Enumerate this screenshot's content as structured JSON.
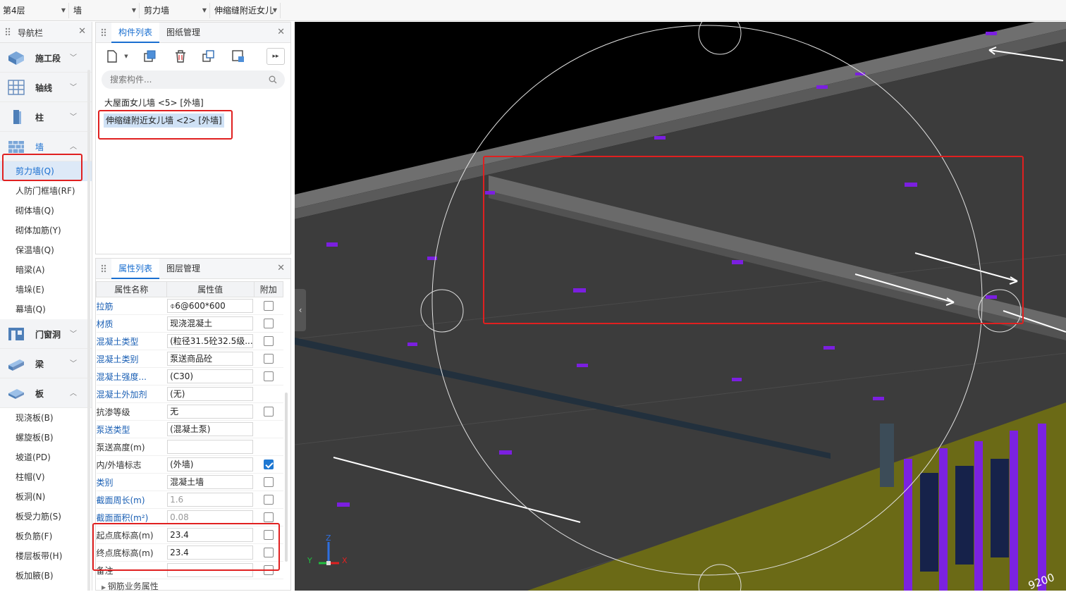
{
  "topbar": {
    "floor": "第4层",
    "type": "墙",
    "subtype": "剪力墙",
    "component": "伸缩缝附近女儿"
  },
  "nav": {
    "title": "导航栏",
    "cats": {
      "stage": "施工段",
      "axis": "轴线",
      "column": "柱",
      "wall": "墙",
      "opening": "门窗洞",
      "beam": "梁",
      "slab": "板"
    },
    "wall_items": [
      "剪力墙(Q)",
      "人防门框墙(RF)",
      "砌体墙(Q)",
      "砌体加筋(Y)",
      "保温墙(Q)",
      "暗梁(A)",
      "墙垛(E)",
      "幕墙(Q)"
    ],
    "slab_items": [
      "现浇板(B)",
      "螺旋板(B)",
      "坡道(PD)",
      "柱帽(V)",
      "板洞(N)",
      "板受力筋(S)",
      "板负筋(F)",
      "楼层板带(H)",
      "板加腋(B)"
    ]
  },
  "component_panel": {
    "tab1": "构件列表",
    "tab2": "图纸管理",
    "search_placeholder": "搜索构件...",
    "items": [
      "大屋面女儿墙 <5> [外墙]",
      "伸缩缝附近女儿墙 <2> [外墙]"
    ]
  },
  "props_panel": {
    "tab1": "属性列表",
    "tab2": "图层管理",
    "col_name": "属性名称",
    "col_value": "属性值",
    "col_extra": "附加",
    "rows": [
      {
        "name": "拉筋",
        "value": "⌽6@600*600"
      },
      {
        "name": "材质",
        "value": "现浇混凝土"
      },
      {
        "name": "混凝土类型",
        "value": "(粒径31.5砼32.5级..."
      },
      {
        "name": "混凝土类别",
        "value": "泵送商品砼"
      },
      {
        "name": "混凝土强度...",
        "value": "(C30)"
      },
      {
        "name": "混凝土外加剂",
        "value": "(无)"
      },
      {
        "name": "抗渗等级",
        "value": "无"
      },
      {
        "name": "泵送类型",
        "value": "(混凝土泵)"
      },
      {
        "name": "泵送高度(m)",
        "value": ""
      },
      {
        "name": "内/外墙标志",
        "value": "(外墙)"
      },
      {
        "name": "类别",
        "value": "混凝土墙"
      },
      {
        "name": "截面周长(m)",
        "value": "1.6"
      },
      {
        "name": "截面面积(m²)",
        "value": "0.08"
      },
      {
        "name": "起点底标高(m)",
        "value": "23.4"
      },
      {
        "name": "终点底标高(m)",
        "value": "23.4"
      },
      {
        "name": "备注",
        "value": ""
      }
    ],
    "group": "钢筋业务属性"
  },
  "viewport": {
    "dim_label": "9200",
    "axis_x": "X",
    "axis_y": "Y",
    "axis_z": "Z"
  }
}
